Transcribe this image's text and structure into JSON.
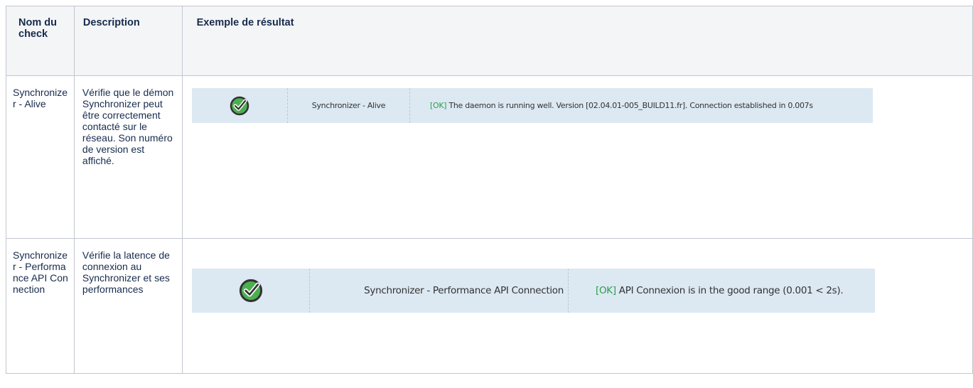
{
  "table": {
    "headers": {
      "name": "Nom du check",
      "description": "Description",
      "example": "Exemple de résultat"
    },
    "rows": [
      {
        "name": "Synchronizer - Alive",
        "description": "Vérifie que le démon Synchronizer peut être correctement contacté sur le réseau. Son numéro de version est affiché.",
        "example": {
          "icon": "check-circle-icon",
          "check_label": "Synchronizer - Alive",
          "status": "[OK]",
          "message": " The daemon is running well. Version [02.04.01-005_BUILD11.fr]. Connection established in 0.007s"
        }
      },
      {
        "name": "Synchronizer - Performance API Connection",
        "description": "Vérifie la latence de connexion au Synchronizer et ses performances",
        "example": {
          "icon": "check-circle-icon",
          "check_label": "Synchronizer - Performance API Connection",
          "status": "[OK]",
          "message": " API Connexion is in the good range (0.001 < 2s)."
        }
      }
    ]
  },
  "colors": {
    "header_bg": "#f4f5f7",
    "border": "#c1c7d0",
    "result_bg": "#dce8f2",
    "ok_green": "#2e9e4b",
    "icon_green": "#4caf50"
  }
}
